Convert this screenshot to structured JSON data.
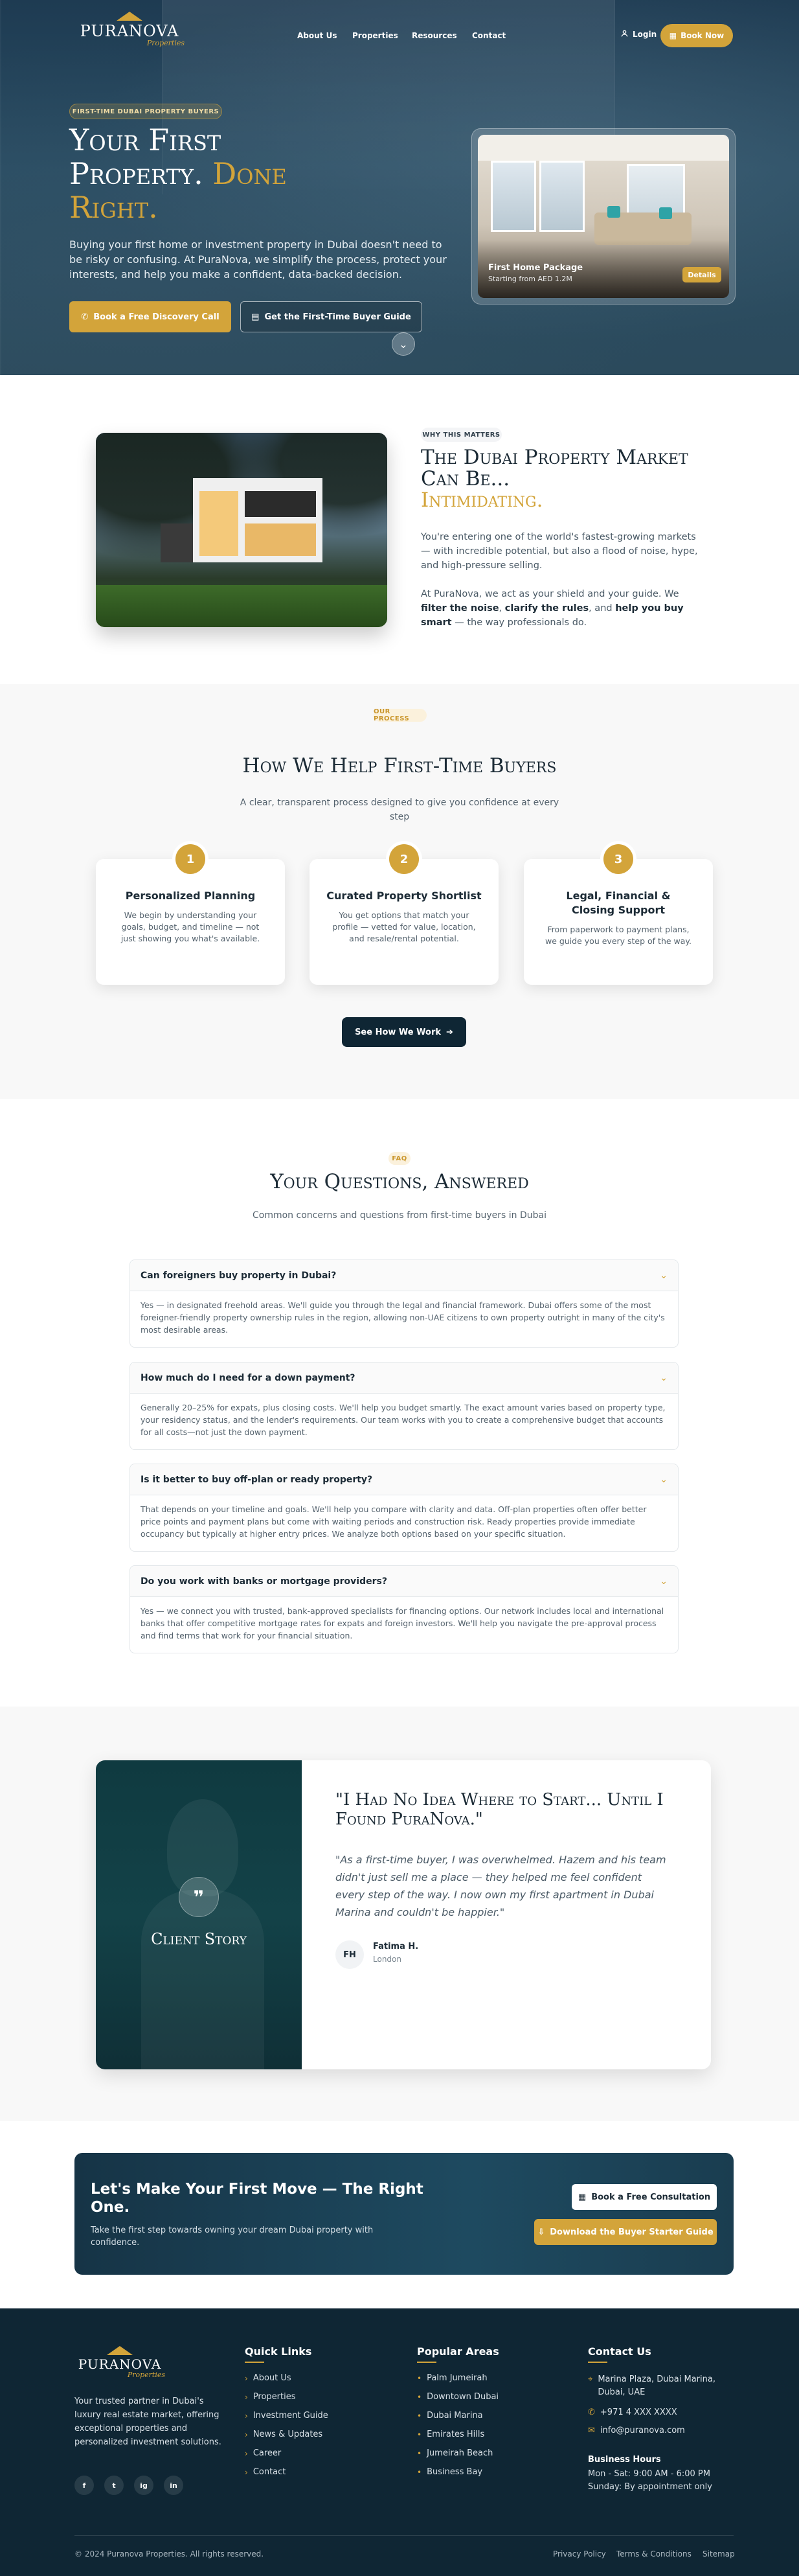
{
  "brand": {
    "name": "PURANOVA",
    "tagline": "Properties"
  },
  "nav": {
    "items": [
      "About Us",
      "Properties",
      "Resources",
      "Contact"
    ],
    "login": "Login",
    "book": "Book Now"
  },
  "hero": {
    "badge": "FIRST-TIME DUBAI PROPERTY BUYERS",
    "title_line1": "Your First",
    "title_line2a": "Property.",
    "title_line2b": "Done",
    "title_line3": "Right.",
    "desc": "Buying your first home or investment property in Dubai doesn't need to be risky or confusing. At PuraNova, we simplify the process, protect your interests, and help you make a confident, data-backed decision.",
    "cta1": "Book a Free Discovery Call",
    "cta2": "Get the First-Time Buyer Guide",
    "card": {
      "title": "First Home Package",
      "subtitle": "Starting from AED 1.2M",
      "button": "Details"
    }
  },
  "why": {
    "tag": "WHY THIS MATTERS",
    "title_a": "The Dubai Property Market Can Be...",
    "title_b": "Intimidating.",
    "p1": "You're entering one of the world's fastest-growing markets — with incredible potential, but also a flood of noise, hype, and high-pressure selling.",
    "p2_a": "At PuraNova, we act as your shield and your guide. We ",
    "p2_b1": "filter the noise",
    "p2_c": ", ",
    "p2_b2": "clarify the rules",
    "p2_d": ", and ",
    "p2_b3": "help you buy smart",
    "p2_e": " — the way professionals do."
  },
  "process": {
    "tag": "OUR PROCESS",
    "title": "How We Help First-Time Buyers",
    "subtitle": "A clear, transparent process designed to give you confidence at every step",
    "steps": [
      {
        "num": "1",
        "title": "Personalized Planning",
        "text": "We begin by understanding your goals, budget, and timeline — not just showing you what's available."
      },
      {
        "num": "2",
        "title": "Curated Property Shortlist",
        "text": "You get options that match your profile — vetted for value, location, and resale/rental potential."
      },
      {
        "num": "3",
        "title": "Legal, Financial & Closing Support",
        "text": "From paperwork to payment plans, we guide you every step of the way."
      }
    ],
    "button": "See How We Work"
  },
  "faq": {
    "tag": "FAQ",
    "title": "Your Questions, Answered",
    "subtitle": "Common concerns and questions from first-time buyers in Dubai",
    "items": [
      {
        "q": "Can foreigners buy property in Dubai?",
        "a": "Yes — in designated freehold areas. We'll guide you through the legal and financial framework. Dubai offers some of the most foreigner-friendly property ownership rules in the region, allowing non-UAE citizens to own property outright in many of the city's most desirable areas."
      },
      {
        "q": "How much do I need for a down payment?",
        "a": "Generally 20–25% for expats, plus closing costs. We'll help you budget smartly. The exact amount varies based on property type, your residency status, and the lender's requirements. Our team works with you to create a comprehensive budget that accounts for all costs—not just the down payment."
      },
      {
        "q": "Is it better to buy off-plan or ready property?",
        "a": "That depends on your timeline and goals. We'll help you compare with clarity and data. Off-plan properties often offer better price points and payment plans but come with waiting periods and construction risk. Ready properties provide immediate occupancy but typically at higher entry prices. We analyze both options based on your specific situation."
      },
      {
        "q": "Do you work with banks or mortgage providers?",
        "a": "Yes — we connect you with trusted, bank-approved specialists for financing options. Our network includes local and international banks that offer competitive mortgage rates for expats and foreign investors. We'll help you navigate the pre-approval process and find terms that work for your financial situation."
      }
    ]
  },
  "testimonial": {
    "label": "Client Story",
    "headline": "\"I Had No Idea Where to Start... Until I Found PuraNova.\"",
    "quote": "\"As a first-time buyer, I was overwhelmed. Hazem and his team didn't just sell me a place — they helped me feel confident every step of the way. I now own my first apartment in Dubai Marina and couldn't be happier.\"",
    "initials": "FH",
    "name": "Fatima H.",
    "location": "London"
  },
  "cta": {
    "title": "Let's Make Your First Move — The Right One.",
    "subtitle": "Take the first step towards owning your dream Dubai property with confidence.",
    "btn1": "Book a Free Consultation",
    "btn2": "Download the Buyer Starter Guide"
  },
  "footer": {
    "about": "Your trusted partner in Dubai's luxury real estate market, offering exceptional properties and personalized investment solutions.",
    "social": [
      "f",
      "t",
      "ig",
      "in"
    ],
    "quick_title": "Quick Links",
    "quick": [
      "About Us",
      "Properties",
      "Investment Guide",
      "News & Updates",
      "Career",
      "Contact"
    ],
    "areas_title": "Popular Areas",
    "areas": [
      "Palm Jumeirah",
      "Downtown Dubai",
      "Dubai Marina",
      "Emirates Hills",
      "Jumeirah Beach",
      "Business Bay"
    ],
    "contact_title": "Contact Us",
    "address": "Marina Plaza, Dubai Marina, Dubai, UAE",
    "phone": "+971 4 XXX XXXX",
    "email": "info@puranova.com",
    "hours_title": "Business Hours",
    "hours1": "Mon - Sat: 9:00 AM - 6:00 PM",
    "hours2": "Sunday: By appointment only",
    "copyright": "© 2024 Puranova Properties. All rights reserved.",
    "legal": [
      "Privacy Policy",
      "Terms & Conditions",
      "Sitemap"
    ]
  }
}
